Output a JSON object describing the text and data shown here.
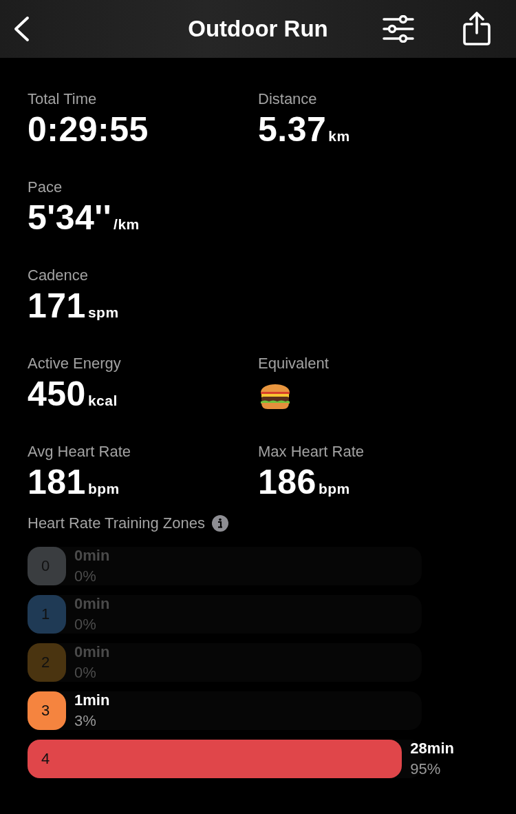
{
  "header": {
    "title": "Outdoor Run"
  },
  "metrics": [
    {
      "label": "Total Time",
      "value": "0:29:55",
      "kind": "value"
    },
    {
      "label": "Distance",
      "value": "5.37",
      "unit": "km",
      "kind": "value"
    },
    {
      "label": "Pace",
      "value": "5'34''",
      "unit": "/km",
      "kind": "value"
    },
    {
      "kind": "blank"
    },
    {
      "label": "Cadence",
      "value": "171",
      "unit": "spm",
      "kind": "value"
    },
    {
      "kind": "blank"
    },
    {
      "label": "Active Energy",
      "value": "450",
      "unit": "kcal",
      "kind": "value"
    },
    {
      "label": "Equivalent",
      "kind": "burger"
    },
    {
      "label": "Avg Heart Rate",
      "value": "181",
      "unit": "bpm",
      "kind": "value"
    },
    {
      "label": "Max Heart Rate",
      "value": "186",
      "unit": "bpm",
      "kind": "value"
    }
  ],
  "zones": {
    "title": "Heart Rate Training Zones",
    "items": [
      {
        "zone": "0",
        "time": "0min",
        "percent": "0%",
        "level": 0,
        "color": "#3a3d40"
      },
      {
        "zone": "1",
        "time": "0min",
        "percent": "0%",
        "level": 0,
        "color": "#1f3a55"
      },
      {
        "zone": "2",
        "time": "0min",
        "percent": "0%",
        "level": 0,
        "color": "#4a3410"
      },
      {
        "zone": "3",
        "time": "1min",
        "percent": "3%",
        "level": 0.03,
        "color": "#f5843f"
      },
      {
        "zone": "4",
        "time": "28min",
        "percent": "95%",
        "level": 0.95,
        "color": "#e0464a"
      }
    ]
  }
}
